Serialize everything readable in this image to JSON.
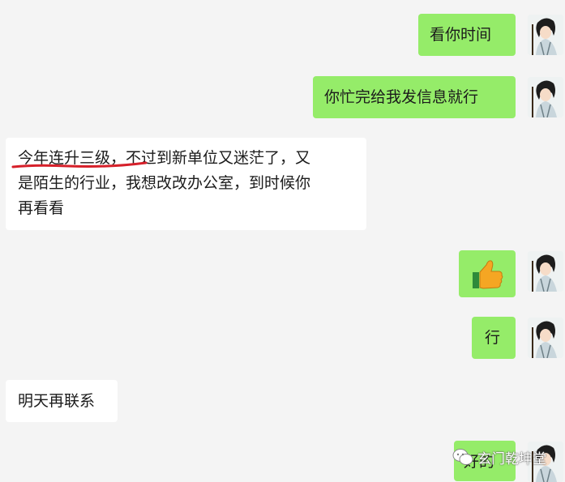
{
  "chat": {
    "messages": [
      {
        "side": "out",
        "type": "text",
        "text": "看你时间"
      },
      {
        "side": "out",
        "type": "text",
        "text": "你忙完给我发信息就行"
      },
      {
        "side": "in",
        "type": "text",
        "lines": [
          "今年连升三级，不过到新单位又迷茫了，又",
          "是陌生的行业，我想改改办公室，到时候你",
          "再看看"
        ]
      },
      {
        "side": "out",
        "type": "emoji",
        "icon": "thumbs-up-icon"
      },
      {
        "side": "out",
        "type": "text",
        "text": "行"
      },
      {
        "side": "in",
        "type": "text",
        "text": "明天再联系"
      },
      {
        "side": "out",
        "type": "text",
        "text": "好的"
      }
    ]
  },
  "watermark": {
    "text": "玄门乾坤堂",
    "icon": "wechat-icon"
  },
  "colors": {
    "background": "#f4f4f4",
    "outgoing_bubble": "#95ec69",
    "incoming_bubble": "#ffffff",
    "annotation_red": "#d6202a"
  }
}
